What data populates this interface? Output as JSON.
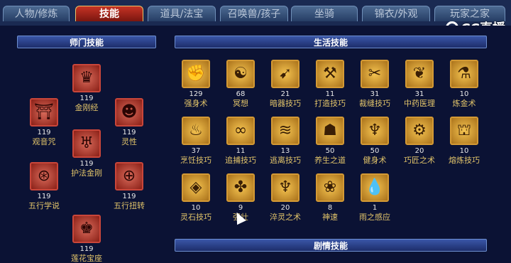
{
  "tabs": [
    {
      "label": "人物/修炼",
      "active": false
    },
    {
      "label": "技能",
      "active": true
    },
    {
      "label": "道具/法宝",
      "active": false
    },
    {
      "label": "召唤兽/孩子",
      "active": false
    },
    {
      "label": "坐骑",
      "active": false
    },
    {
      "label": "锦衣/外观",
      "active": false
    },
    {
      "label": "玩家之家",
      "active": false
    }
  ],
  "watermark": "CC直播",
  "sections": {
    "master": "师门技能",
    "life": "生活技能",
    "story": "剧情技能"
  },
  "master_skills": [
    {
      "level": "119",
      "name": "观音咒",
      "icon": "pagoda-icon"
    },
    {
      "level": "119",
      "name": "金刚经",
      "icon": "crown-icon"
    },
    {
      "level": "119",
      "name": "护法金刚",
      "icon": "guardian-icon"
    },
    {
      "level": "119",
      "name": "灵性",
      "icon": "head-icon"
    },
    {
      "level": "119",
      "name": "五行学说",
      "icon": "wheel-icon"
    },
    {
      "level": "119",
      "name": "五行扭转",
      "icon": "orb-icon"
    },
    {
      "level": "119",
      "name": "莲花宝座",
      "icon": "lotus-throne-icon"
    }
  ],
  "life_skills": [
    {
      "level": "129",
      "name": "强身术",
      "icon": "strength-icon",
      "glyph": "✊"
    },
    {
      "level": "68",
      "name": "冥想",
      "icon": "meditation-icon",
      "glyph": "☯"
    },
    {
      "level": "21",
      "name": "暗器技巧",
      "icon": "dart-icon",
      "glyph": "➹"
    },
    {
      "level": "11",
      "name": "打造技巧",
      "icon": "forge-icon",
      "glyph": "⚒"
    },
    {
      "level": "31",
      "name": "裁缝技巧",
      "icon": "scissors-icon",
      "glyph": "✂"
    },
    {
      "level": "31",
      "name": "中药医理",
      "icon": "herb-icon",
      "glyph": "❦"
    },
    {
      "level": "10",
      "name": "炼金术",
      "icon": "alchemy-icon",
      "glyph": "⚗"
    },
    {
      "level": "37",
      "name": "烹饪技巧",
      "icon": "cooking-icon",
      "glyph": "♨"
    },
    {
      "level": "11",
      "name": "追捕技巧",
      "icon": "mask-icon",
      "glyph": "∞"
    },
    {
      "level": "13",
      "name": "逃离技巧",
      "icon": "escape-icon",
      "glyph": "≋"
    },
    {
      "level": "50",
      "name": "养生之道",
      "icon": "wellness-icon",
      "glyph": "☗"
    },
    {
      "level": "50",
      "name": "健身术",
      "icon": "fitness-icon",
      "glyph": "♆"
    },
    {
      "level": "20",
      "name": "巧匠之术",
      "icon": "craft-icon",
      "glyph": "⚙"
    },
    {
      "level": "10",
      "name": "熔炼技巧",
      "icon": "smelt-icon",
      "glyph": "⛫"
    },
    {
      "level": "10",
      "name": "灵石技巧",
      "icon": "gem-icon",
      "glyph": "◈"
    },
    {
      "level": "9",
      "name": "强壮",
      "icon": "muscle-icon",
      "glyph": "✤"
    },
    {
      "level": "20",
      "name": "淬灵之术",
      "icon": "goblet-icon",
      "glyph": "♆"
    },
    {
      "level": "8",
      "name": "神速",
      "icon": "speed-icon",
      "glyph": "❀"
    },
    {
      "level": "1",
      "name": "雨之感应",
      "icon": "raindrop-icon",
      "glyph": "💧"
    }
  ],
  "master_glyphs": [
    "⛩",
    "♛",
    "♅",
    "☻",
    "⊛",
    "⊕",
    "♚"
  ]
}
